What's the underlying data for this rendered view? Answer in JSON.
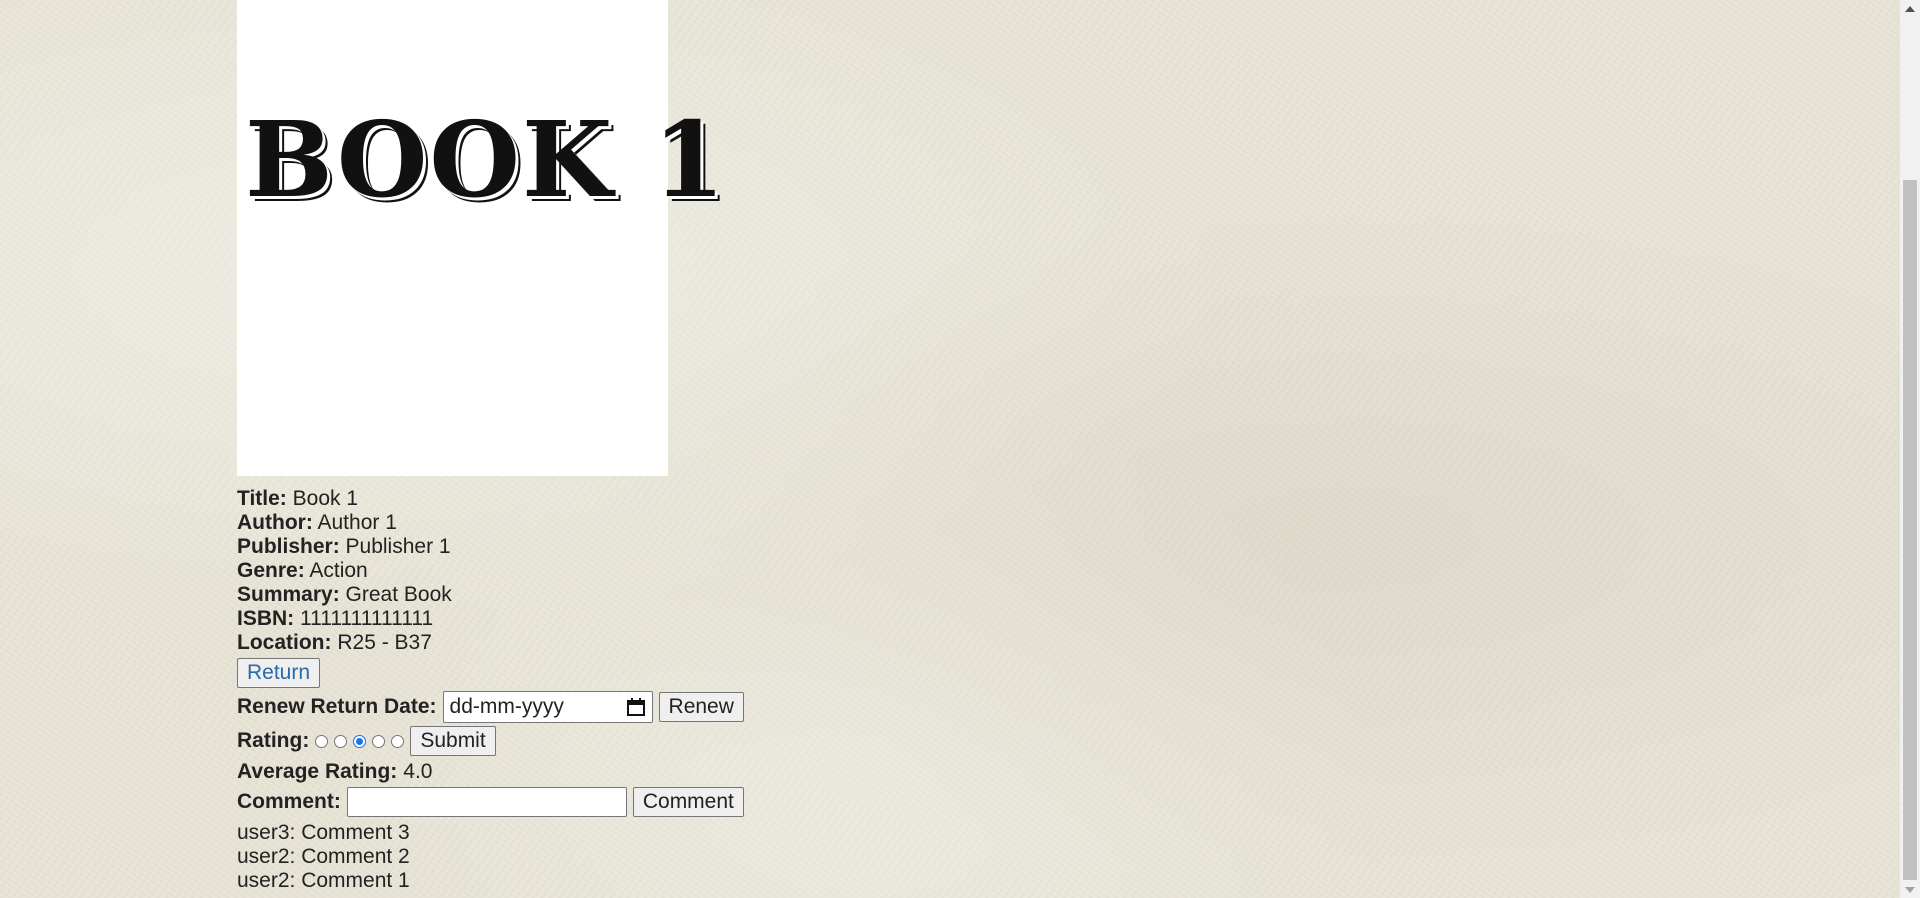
{
  "book": {
    "cover_text": "BOOK 1",
    "fields": [
      {
        "label": "Title:",
        "value": "Book 1"
      },
      {
        "label": "Author:",
        "value": "Author 1"
      },
      {
        "label": "Publisher:",
        "value": "Publisher 1"
      },
      {
        "label": "Genre:",
        "value": "Action"
      },
      {
        "label": "Summary:",
        "value": "Great Book"
      },
      {
        "label": "ISBN:",
        "value": "1111111111111"
      },
      {
        "label": "Location:",
        "value": "R25 - B37"
      }
    ]
  },
  "actions": {
    "return_label": "Return",
    "renew_label_text": "Renew Return Date:",
    "renew_date_placeholder": "dd-mm-yyyy",
    "renew_button": "Renew"
  },
  "rating": {
    "label": "Rating:",
    "options": 5,
    "selected": 3,
    "submit_label": "Submit",
    "average_label": "Average Rating:",
    "average_value": "4.0"
  },
  "comment": {
    "label": "Comment:",
    "value": "",
    "button": "Comment",
    "list": [
      "user3: Comment 3",
      "user2: Comment 2",
      "user2: Comment 1"
    ]
  },
  "colors": {
    "background": "#e8e4d6",
    "return_text": "#2a6aa8",
    "radio_selected": "#1a73e8"
  }
}
